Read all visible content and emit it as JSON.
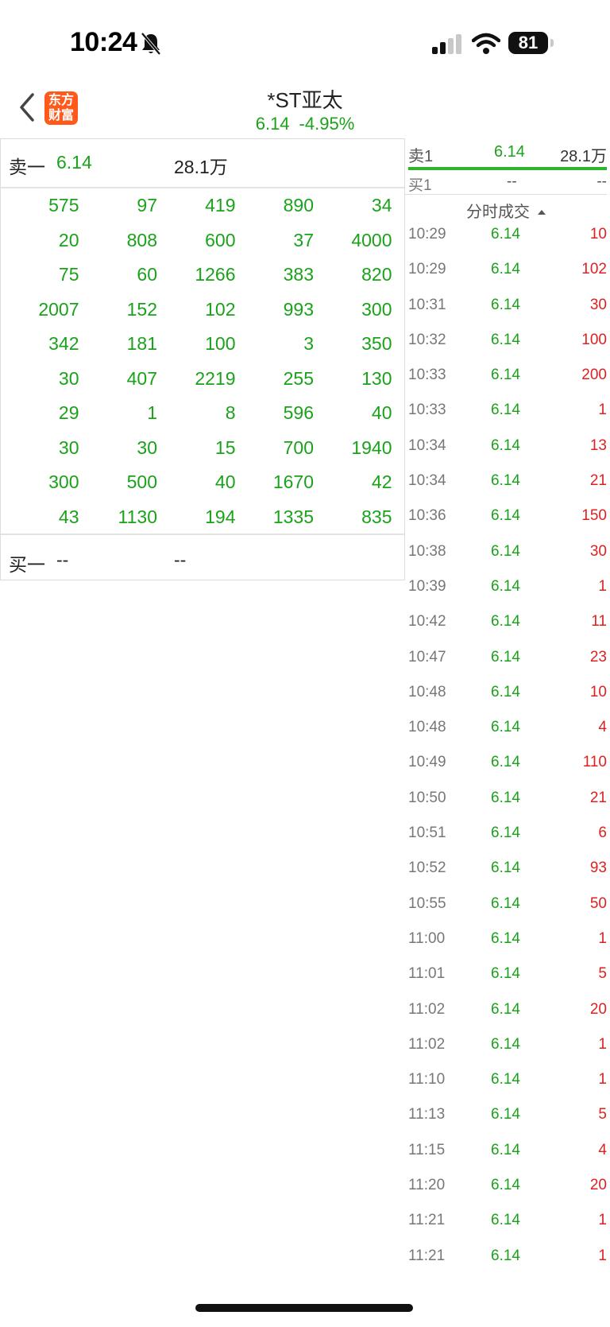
{
  "status_bar": {
    "time": "10:24",
    "battery": "81"
  },
  "header": {
    "logo_line1": "东方",
    "logo_line2": "财富",
    "title": "*ST亚太",
    "price": "6.14",
    "change": "-4.95%"
  },
  "order_book": {
    "sell": {
      "label": "卖一",
      "price": "6.14",
      "volume": "28.1万"
    },
    "queue": [
      [
        "575",
        "97",
        "419",
        "890",
        "34"
      ],
      [
        "20",
        "808",
        "600",
        "37",
        "4000"
      ],
      [
        "75",
        "60",
        "1266",
        "383",
        "820"
      ],
      [
        "2007",
        "152",
        "102",
        "993",
        "300"
      ],
      [
        "342",
        "181",
        "100",
        "3",
        "350"
      ],
      [
        "30",
        "407",
        "2219",
        "255",
        "130"
      ],
      [
        "29",
        "1",
        "8",
        "596",
        "40"
      ],
      [
        "30",
        "30",
        "15",
        "700",
        "1940"
      ],
      [
        "300",
        "500",
        "40",
        "1670",
        "42"
      ],
      [
        "43",
        "1130",
        "194",
        "1335",
        "835"
      ]
    ],
    "buy": {
      "label": "买一",
      "price": "--",
      "volume": "--"
    }
  },
  "level1": {
    "sell": {
      "label": "卖1",
      "price": "6.14",
      "volume": "28.1万"
    },
    "buy": {
      "label": "买1",
      "price": "--",
      "volume": "--"
    }
  },
  "ticks_title": "分时成交",
  "ticks": [
    {
      "time": "10:29",
      "price": "6.14",
      "vol": "10"
    },
    {
      "time": "10:29",
      "price": "6.14",
      "vol": "102"
    },
    {
      "time": "10:31",
      "price": "6.14",
      "vol": "30"
    },
    {
      "time": "10:32",
      "price": "6.14",
      "vol": "100"
    },
    {
      "time": "10:33",
      "price": "6.14",
      "vol": "200"
    },
    {
      "time": "10:33",
      "price": "6.14",
      "vol": "1"
    },
    {
      "time": "10:34",
      "price": "6.14",
      "vol": "13"
    },
    {
      "time": "10:34",
      "price": "6.14",
      "vol": "21"
    },
    {
      "time": "10:36",
      "price": "6.14",
      "vol": "150"
    },
    {
      "time": "10:38",
      "price": "6.14",
      "vol": "30"
    },
    {
      "time": "10:39",
      "price": "6.14",
      "vol": "1"
    },
    {
      "time": "10:42",
      "price": "6.14",
      "vol": "11"
    },
    {
      "time": "10:47",
      "price": "6.14",
      "vol": "23"
    },
    {
      "time": "10:48",
      "price": "6.14",
      "vol": "10"
    },
    {
      "time": "10:48",
      "price": "6.14",
      "vol": "4"
    },
    {
      "time": "10:49",
      "price": "6.14",
      "vol": "110"
    },
    {
      "time": "10:50",
      "price": "6.14",
      "vol": "21"
    },
    {
      "time": "10:51",
      "price": "6.14",
      "vol": "6"
    },
    {
      "time": "10:52",
      "price": "6.14",
      "vol": "93"
    },
    {
      "time": "10:55",
      "price": "6.14",
      "vol": "50"
    },
    {
      "time": "11:00",
      "price": "6.14",
      "vol": "1"
    },
    {
      "time": "11:01",
      "price": "6.14",
      "vol": "5"
    },
    {
      "time": "11:02",
      "price": "6.14",
      "vol": "20"
    },
    {
      "time": "11:02",
      "price": "6.14",
      "vol": "1"
    },
    {
      "time": "11:10",
      "price": "6.14",
      "vol": "1"
    },
    {
      "time": "11:13",
      "price": "6.14",
      "vol": "5"
    },
    {
      "time": "11:15",
      "price": "6.14",
      "vol": "4"
    },
    {
      "time": "11:20",
      "price": "6.14",
      "vol": "20"
    },
    {
      "time": "11:21",
      "price": "6.14",
      "vol": "1"
    },
    {
      "time": "11:21",
      "price": "6.14",
      "vol": "1"
    }
  ],
  "colors": {
    "down_green": "#1aa21a",
    "up_red": "#e02020",
    "brand_orange": "#ff5a1c"
  }
}
